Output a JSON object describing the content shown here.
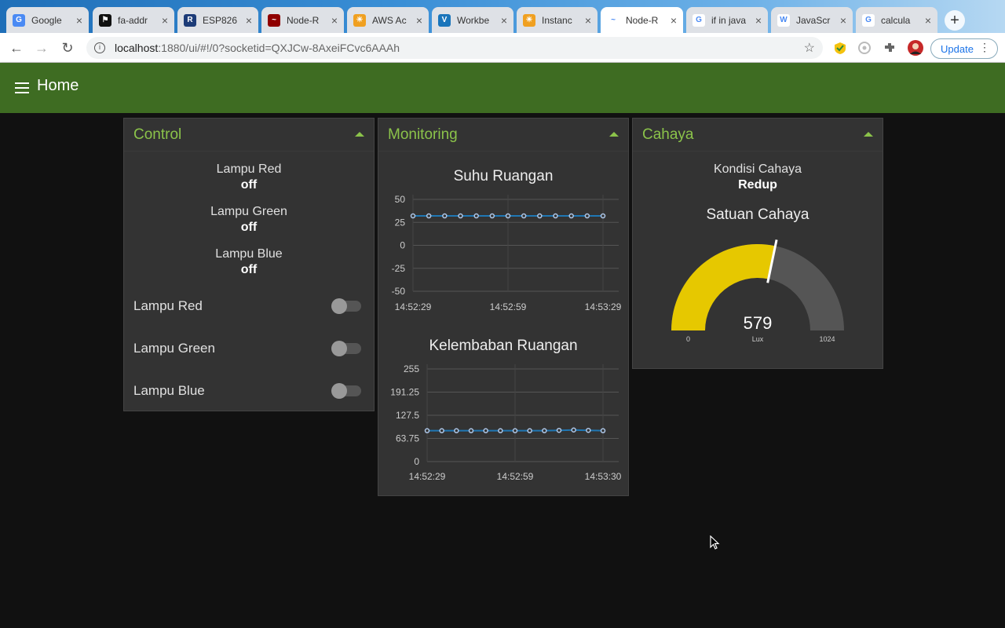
{
  "browser": {
    "tabs": [
      {
        "label": "Google",
        "fav": "G",
        "favcolor": "#4a8af4"
      },
      {
        "label": "fa-addr",
        "fav": "⚑",
        "favcolor": "#111"
      },
      {
        "label": "ESP826",
        "fav": "R",
        "favcolor": "#1d3c78"
      },
      {
        "label": "Node-R",
        "fav": "~",
        "favcolor": "#8f0000"
      },
      {
        "label": "AWS Ac",
        "fav": "☀",
        "favcolor": "#f0a020"
      },
      {
        "label": "Workbe",
        "fav": "V",
        "favcolor": "#1a75bb"
      },
      {
        "label": "Instanc",
        "fav": "☀",
        "favcolor": "#f0a020"
      },
      {
        "label": "Node-R",
        "fav": "~",
        "favcolor": "#fff"
      },
      {
        "label": "if in java",
        "fav": "G",
        "favcolor": "#fff"
      },
      {
        "label": "JavaScr",
        "fav": "W",
        "favcolor": "#fff"
      },
      {
        "label": "calcula",
        "fav": "G",
        "favcolor": "#fff"
      }
    ],
    "active_tab": 7,
    "url_host": "localhost",
    "url_path": ":1880/ui/#!/0?socketid=QXJCw-8AxeiFCvc6AAAh",
    "update_label": "Update",
    "icons": [
      "back-icon",
      "forward-icon",
      "reload-icon",
      "star-icon",
      "extension-icon",
      "profile-avatar",
      "menu-dots-icon"
    ]
  },
  "app": {
    "title": "Home",
    "accent": "#8bc34a",
    "header_color": "#3e6c22"
  },
  "control": {
    "title": "Control",
    "texts": [
      {
        "label": "Lampu Red",
        "value": "off"
      },
      {
        "label": "Lampu Green",
        "value": "off"
      },
      {
        "label": "Lampu Blue",
        "value": "off"
      }
    ],
    "switches": [
      {
        "label": "Lampu Red",
        "on": false
      },
      {
        "label": "Lampu Green",
        "on": false
      },
      {
        "label": "Lampu Blue",
        "on": false
      }
    ]
  },
  "monitoring": {
    "title": "Monitoring"
  },
  "cahaya": {
    "title": "Cahaya",
    "kondisi_label": "Kondisi Cahaya",
    "kondisi_value": "Redup",
    "gauge_title": "Satuan Cahaya",
    "gauge_value": 579,
    "gauge_value_text": "579",
    "gauge_units": "Lux",
    "gauge_min": 0,
    "gauge_max": 1024,
    "gauge_min_text": "0",
    "gauge_max_text": "1024",
    "gauge_color": "#e6c800"
  },
  "chart_data": [
    {
      "type": "line",
      "title": "Suhu Ruangan",
      "ylim": [
        -50,
        50
      ],
      "yticks": [
        "50",
        "25",
        "0",
        "-25",
        "-50"
      ],
      "yticks_values": [
        50,
        25,
        0,
        -25,
        -50
      ],
      "xticks": [
        "14:52:29",
        "14:52:59",
        "14:53:29"
      ],
      "series": [
        {
          "values": [
            32,
            32,
            32,
            32,
            32,
            32,
            32,
            32,
            32,
            32,
            32,
            32,
            32
          ]
        }
      ],
      "grid": true
    },
    {
      "type": "line",
      "title": "Kelembaban Ruangan",
      "ylim": [
        0,
        255
      ],
      "yticks": [
        "255",
        "191.25",
        "127.5",
        "63.75",
        "0"
      ],
      "yticks_values": [
        255,
        191.25,
        127.5,
        63.75,
        0
      ],
      "xticks": [
        "14:52:29",
        "14:52:59",
        "14:53:30"
      ],
      "series": [
        {
          "values": [
            85,
            85,
            85,
            85,
            85,
            85,
            85,
            85,
            85,
            86,
            87,
            86,
            85
          ]
        }
      ],
      "grid": true
    }
  ]
}
